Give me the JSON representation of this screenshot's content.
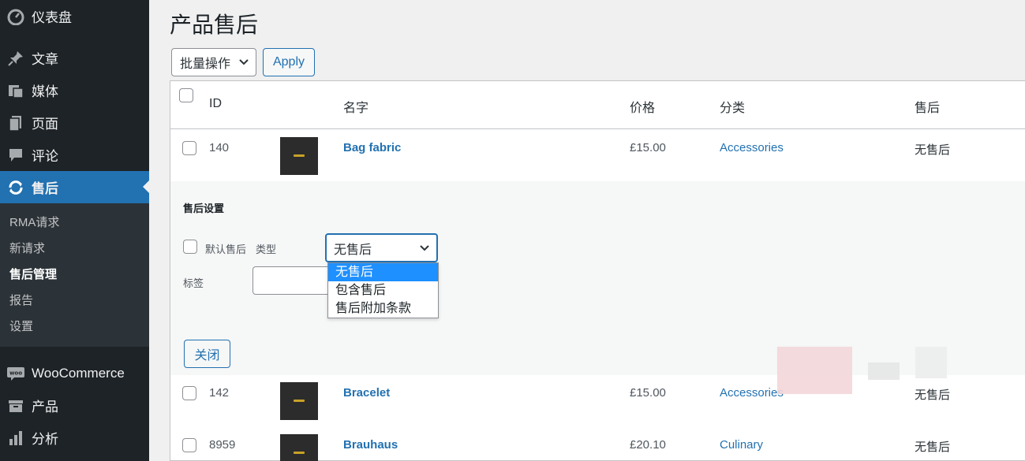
{
  "sidebar": {
    "items": [
      {
        "label": "仪表盘",
        "icon": "dashboard-icon"
      },
      {
        "label": "文章",
        "icon": "pin-icon"
      },
      {
        "label": "媒体",
        "icon": "media-icon"
      },
      {
        "label": "页面",
        "icon": "page-icon"
      },
      {
        "label": "评论",
        "icon": "comment-icon"
      },
      {
        "label": "售后",
        "icon": "refresh-icon"
      }
    ],
    "submenu": [
      "RMA请求",
      "新请求",
      "售后管理",
      "报告",
      "设置"
    ],
    "lower_items": [
      {
        "label": "WooCommerce",
        "icon": "woocommerce-icon"
      },
      {
        "label": "产品",
        "icon": "archive-icon"
      },
      {
        "label": "分析",
        "icon": "bar-chart-icon"
      }
    ]
  },
  "main": {
    "title": "产品售后",
    "bulk_action": "批量操作",
    "apply": "Apply"
  },
  "table": {
    "headers": {
      "id": "ID",
      "name": "名字",
      "price": "价格",
      "category": "分类",
      "aftersale": "售后"
    },
    "rows": [
      {
        "id": "140",
        "name": "Bag fabric",
        "price": "£15.00",
        "category": "Accessories",
        "aftersale": "无售后"
      },
      {
        "id": "142",
        "name": "Bracelet",
        "price": "£15.00",
        "category": "Accessories",
        "aftersale": "无售后"
      },
      {
        "id": "8959",
        "name": "Brauhaus",
        "price": "£20.10",
        "category": "Culinary",
        "aftersale": "无售后"
      }
    ]
  },
  "settings": {
    "title": "售后设置",
    "default_label": "默认售后",
    "type_label": "类型",
    "selected": "无售后",
    "options": [
      "无售后",
      "包含售后",
      "售后附加条款"
    ],
    "tag_label": "标签",
    "close": "关闭"
  },
  "colors": {
    "accent": "#2271b1",
    "sidebar": "#1d2327",
    "submenu": "#2c3338",
    "dropdown_selected": "#1e90ff"
  }
}
